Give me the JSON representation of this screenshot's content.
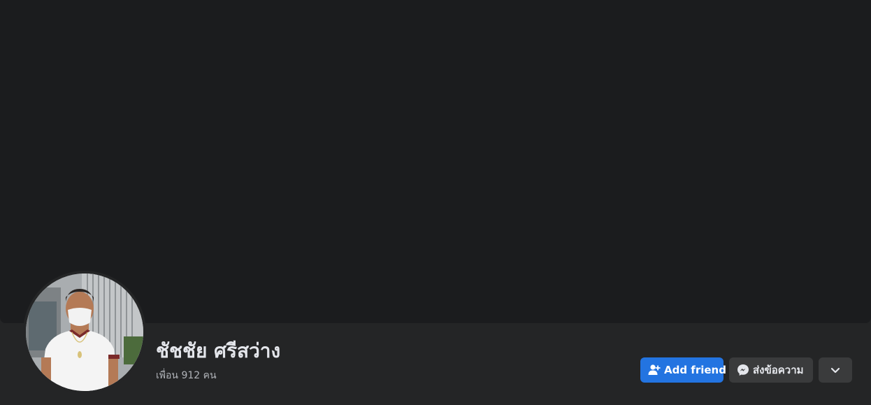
{
  "profile": {
    "name": "ชัชชัย ศรีสว่าง",
    "friends_text": "เพื่อน 912 คน"
  },
  "actions": {
    "add_friend_label": "Add friend",
    "message_label": "ส่งข้อความ"
  },
  "icons": {
    "add_friend": "add-person-icon",
    "message": "messenger-icon",
    "more": "chevron-down-icon"
  },
  "colors": {
    "background": "#242526",
    "cover": "#1b1c1e",
    "primary_button": "#2374e1",
    "secondary_button": "#3a3b3c",
    "text_primary": "#e4e6eb",
    "text_secondary": "#b0b3b8"
  }
}
